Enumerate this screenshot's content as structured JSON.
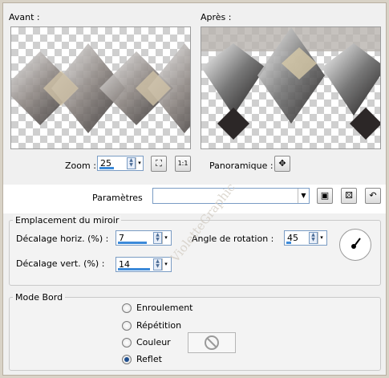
{
  "preview": {
    "before_label": "Avant :",
    "after_label": "Après :",
    "zoom_label": "Zoom :",
    "zoom_value": "25",
    "panorama_label": "Panoramique :"
  },
  "presets": {
    "label": "Paramètres",
    "value": ""
  },
  "mirror_group": {
    "title": "Emplacement du miroir",
    "h_offset_label": "Décalage horiz. (%) :",
    "h_offset_value": "7",
    "v_offset_label": "Décalage vert. (%) :",
    "v_offset_value": "14",
    "angle_label": "Angle de rotation :",
    "angle_value": "45"
  },
  "edge_group": {
    "title": "Mode Bord",
    "options": [
      "Enroulement",
      "Répétition",
      "Couleur",
      "Reflet"
    ],
    "selected": "Reflet"
  },
  "watermark": "VioletteGraphic",
  "colors": {
    "accent": "#3c8ad9",
    "checker": "#cfcfcf",
    "panel": "#f0f0f0"
  }
}
